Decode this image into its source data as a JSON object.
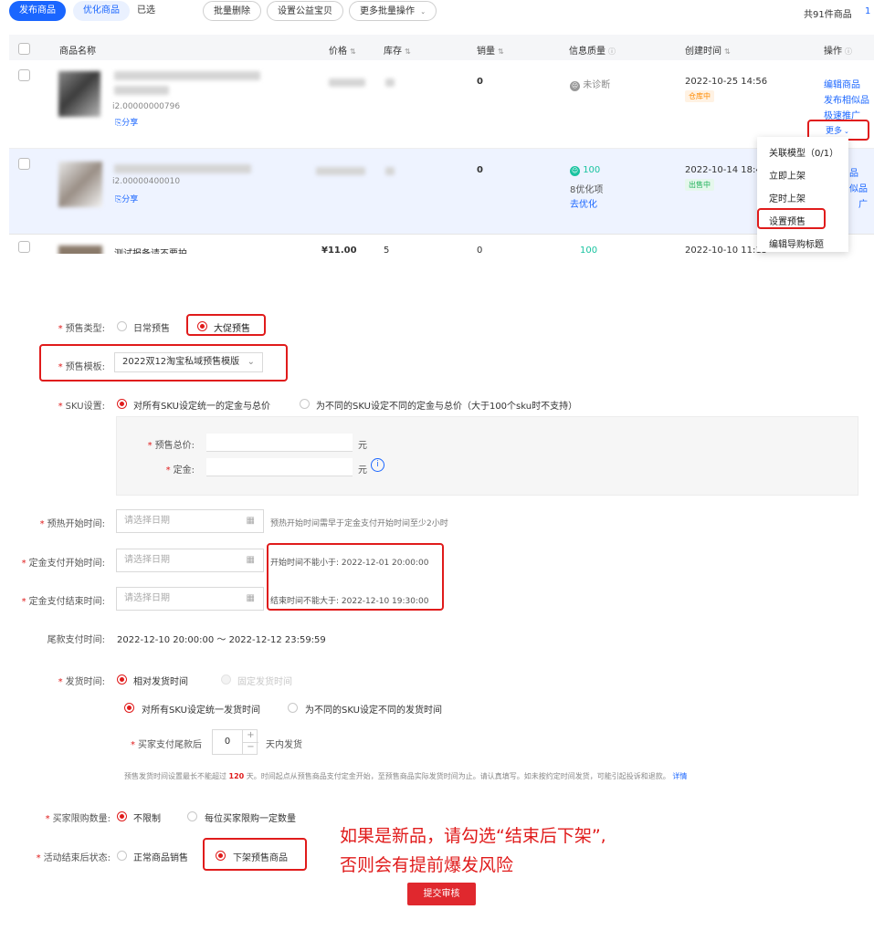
{
  "toolbar": {
    "publish": "发布商品",
    "optimize": "优化商品",
    "selected": "已选",
    "batch_delete": "批量删除",
    "set_charity": "设置公益宝贝",
    "more_batch": "更多批量操作",
    "total": "共91件商品",
    "page_partial": "1"
  },
  "table": {
    "headers": [
      "商品名称",
      "价格",
      "库存",
      "销量",
      "信息质量",
      "创建时间",
      "操作"
    ],
    "rows": [
      {
        "id_partial": "i2.00000000796",
        "share": "分享",
        "sales": "0",
        "quality": "未诊断",
        "created": "2022-10-25 14:56",
        "status": "仓库中",
        "ops": [
          "编辑商品",
          "发布相似品",
          "极速推广",
          "更多"
        ]
      },
      {
        "id_partial": "i2.00000400010",
        "share": "分享",
        "sales": "0",
        "quality_score": "100",
        "quality_items": "8优化项",
        "quality_link": "去优化",
        "created": "2022-10-14 18:4",
        "status": "出售中",
        "ops_partial": [
          "品",
          "似品",
          "广"
        ]
      },
      {
        "name_partial": "测试报备请不要拍",
        "price_partial": "¥11.00",
        "stock_partial": "5",
        "sales": "0",
        "quality_score": "100",
        "created": "2022-10-10 11:15"
      }
    ]
  },
  "dropdown_menu": [
    "关联模型（0/1）",
    "立即上架",
    "定时上架",
    "设置预售",
    "编辑导购标题"
  ],
  "form": {
    "presale_type_label": "预售类型:",
    "presale_type_options": [
      "日常预售",
      "大促预售"
    ],
    "template_label": "预售模板:",
    "template_value": "2022双12淘宝私域预售模版",
    "sku_label": "SKU设置:",
    "sku_options": [
      "对所有SKU设定统一的定金与总价",
      "为不同的SKU设定不同的定金与总价（大于100个sku时不支持）"
    ],
    "total_price_label": "预售总价:",
    "deposit_label": "定金:",
    "yuan": "元",
    "preheat_label": "预热开始时间:",
    "date_placeholder": "请选择日期",
    "preheat_hint": "预热开始时间需早于定金支付开始时间至少2小时",
    "deposit_start_label": "定金支付开始时间:",
    "deposit_start_hint": "开始时间不能小于:  2022-12-01 20:00:00",
    "deposit_end_label": "定金支付结束时间:",
    "deposit_end_hint": "结束时间不能大于:  2022-12-10 19:30:00",
    "final_pay_label": "尾款支付时间:",
    "final_pay_value": "2022-12-10 20:00:00  ～  2022-12-12 23:59:59",
    "ship_label": "发货时间:",
    "ship_options": [
      "相对发货时间",
      "固定发货时间"
    ],
    "ship_sku_options": [
      "对所有SKU设定统一发货时间",
      "为不同的SKU设定不同的发货时间"
    ],
    "ship_after_label": "买家支付尾款后",
    "ship_days": "0",
    "ship_after_suffix": "天内发货",
    "ship_note": "预售发货时间设置最长不能超过",
    "ship_note_days": "120",
    "ship_note_rest": "天。时间起点从预售商品支付定金开始，至预售商品实际发货时间为止。请认真填写。如未按约定时间发货，可能引起投诉和退款。",
    "ship_note_link": "详情",
    "limit_label": "买家限购数量:",
    "limit_options": [
      "不限制",
      "每位买家限购一定数量"
    ],
    "end_status_label": "活动结束后状态:",
    "end_status_options": [
      "正常商品销售",
      "下架预售商品"
    ],
    "submit": "提交审核"
  },
  "annotation": {
    "line1": "如果是新品，请勾选“结束后下架”,",
    "line2": "否则会有提前爆发风险"
  },
  "colors": {
    "primary_blue": "#1a66ff",
    "highlight_red": "#e01b1b",
    "submit_red": "#e0282e",
    "status_orange": "#ff8a00",
    "status_green": "#20b15a",
    "quality_teal": "#19c3a0"
  }
}
